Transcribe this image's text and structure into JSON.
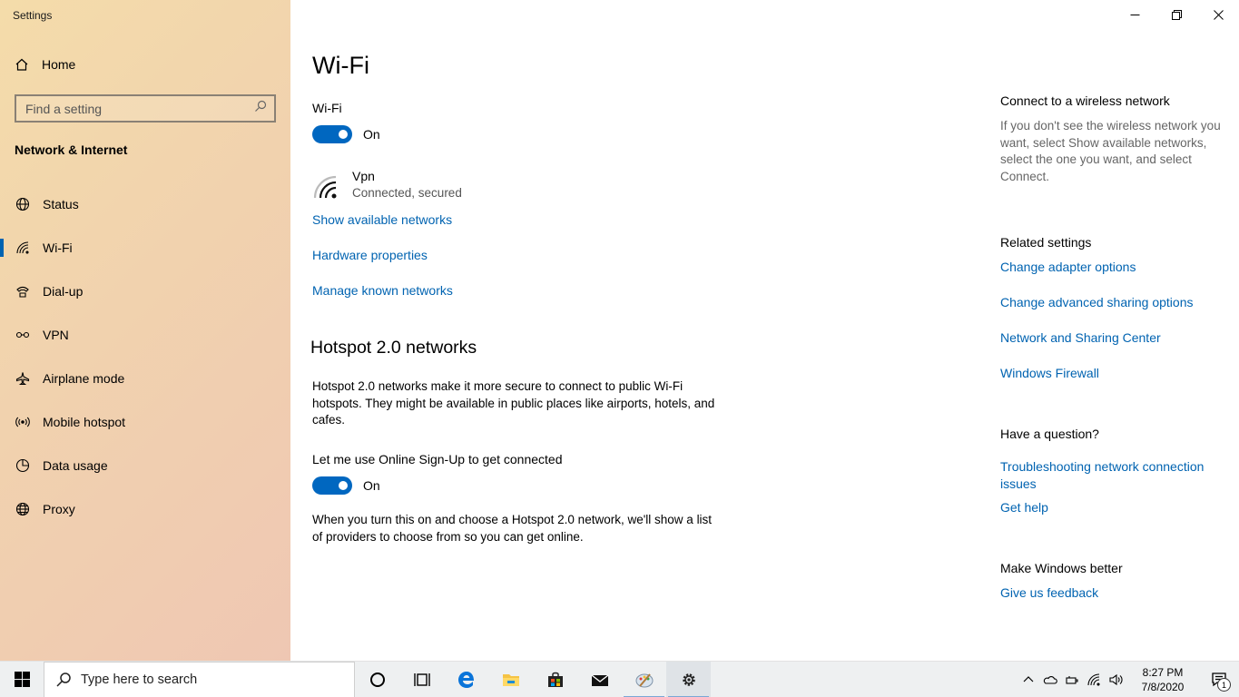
{
  "app": {
    "title": "Settings"
  },
  "sidebar": {
    "home_label": "Home",
    "search_placeholder": "Find a setting",
    "section_title": "Network & Internet",
    "items": [
      {
        "label": "Status",
        "icon": "globe-status-icon"
      },
      {
        "label": "Wi-Fi",
        "icon": "wifi-icon",
        "active": true
      },
      {
        "label": "Dial-up",
        "icon": "dialup-icon"
      },
      {
        "label": "VPN",
        "icon": "vpn-icon"
      },
      {
        "label": "Airplane mode",
        "icon": "airplane-icon"
      },
      {
        "label": "Mobile hotspot",
        "icon": "hotspot-icon"
      },
      {
        "label": "Data usage",
        "icon": "data-usage-icon"
      },
      {
        "label": "Proxy",
        "icon": "globe-icon"
      }
    ]
  },
  "main": {
    "title": "Wi-Fi",
    "wifi_label": "Wi-Fi",
    "wifi_toggle": "On",
    "network": {
      "name": "Vpn",
      "status": "Connected, secured"
    },
    "links": {
      "show_networks": "Show available networks",
      "hardware": "Hardware properties",
      "manage": "Manage known networks"
    },
    "hotspot": {
      "heading": "Hotspot 2.0 networks",
      "description": "Hotspot 2.0 networks make it more secure to connect to public Wi-Fi hotspots. They might be available in public places like airports, hotels, and cafes.",
      "osu_label": "Let me use Online Sign-Up to get connected",
      "osu_toggle": "On",
      "osu_description": "When you turn this on and choose a Hotspot 2.0 network, we'll show a list of providers to choose from so you can get online."
    }
  },
  "right": {
    "connect_heading": "Connect to a wireless network",
    "connect_text": "If you don't see the wireless network you want, select Show available networks, select the one you want, and select Connect.",
    "related_heading": "Related settings",
    "related_links": [
      "Change adapter options",
      "Change advanced sharing options",
      "Network and Sharing Center",
      "Windows Firewall"
    ],
    "question_heading": "Have a question?",
    "question_links": [
      "Troubleshooting network connection issues",
      "Get help"
    ],
    "better_heading": "Make Windows better",
    "feedback_link": "Give us feedback"
  },
  "taskbar": {
    "search_placeholder": "Type here to search",
    "time": "8:27 PM",
    "date": "7/8/2020",
    "notification_count": "1",
    "accent": "#0063b1"
  }
}
